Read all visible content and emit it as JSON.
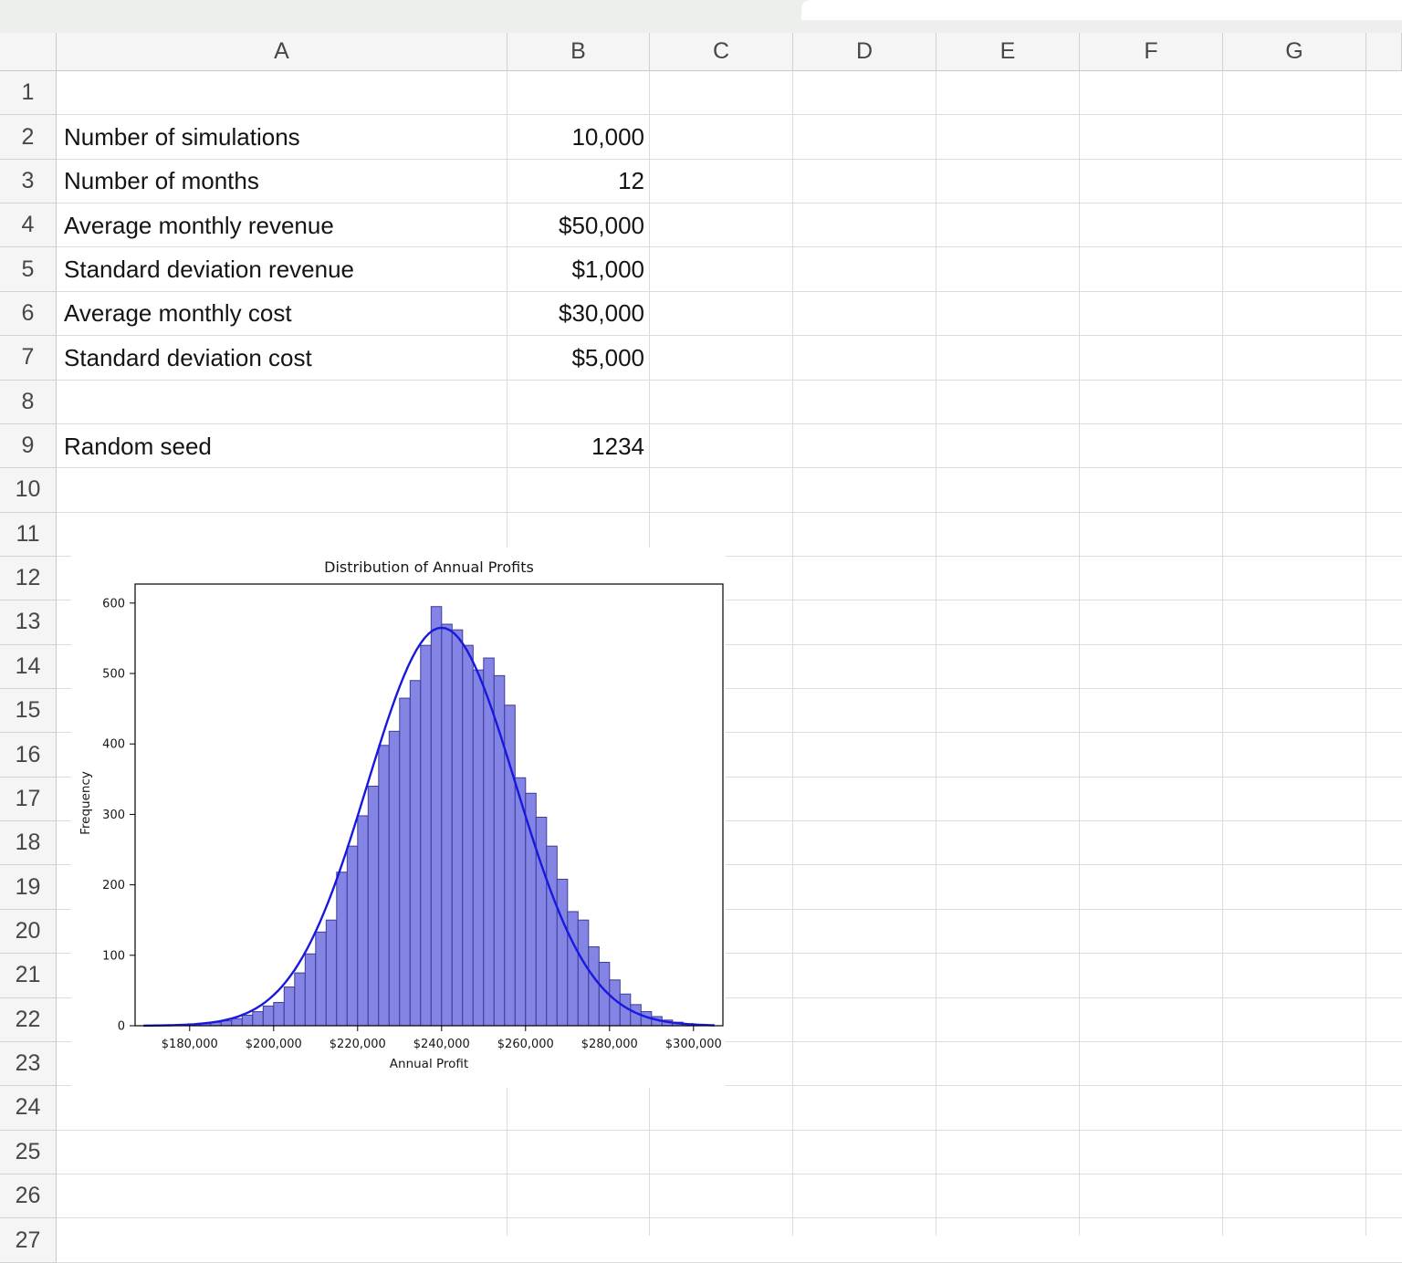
{
  "grid": {
    "columns": [
      "A",
      "B",
      "C",
      "D",
      "E",
      "F",
      "G"
    ],
    "row_count": 27,
    "cells": [
      {
        "ref": "A2",
        "row": 2,
        "col": "A",
        "text": "Number of simulations",
        "align": "left"
      },
      {
        "ref": "B2",
        "row": 2,
        "col": "B",
        "text": "10,000",
        "align": "right"
      },
      {
        "ref": "A3",
        "row": 3,
        "col": "A",
        "text": "Number of months",
        "align": "left"
      },
      {
        "ref": "B3",
        "row": 3,
        "col": "B",
        "text": "12",
        "align": "right"
      },
      {
        "ref": "A4",
        "row": 4,
        "col": "A",
        "text": "Average monthly revenue",
        "align": "left"
      },
      {
        "ref": "B4",
        "row": 4,
        "col": "B",
        "text": "$50,000",
        "align": "right"
      },
      {
        "ref": "A5",
        "row": 5,
        "col": "A",
        "text": "Standard deviation revenue",
        "align": "left"
      },
      {
        "ref": "B5",
        "row": 5,
        "col": "B",
        "text": "$1,000",
        "align": "right"
      },
      {
        "ref": "A6",
        "row": 6,
        "col": "A",
        "text": "Average monthly cost",
        "align": "left"
      },
      {
        "ref": "B6",
        "row": 6,
        "col": "B",
        "text": "$30,000",
        "align": "right"
      },
      {
        "ref": "A7",
        "row": 7,
        "col": "A",
        "text": "Standard deviation cost",
        "align": "left"
      },
      {
        "ref": "B7",
        "row": 7,
        "col": "B",
        "text": "$5,000",
        "align": "right"
      },
      {
        "ref": "A9",
        "row": 9,
        "col": "A",
        "text": "Random seed",
        "align": "left"
      },
      {
        "ref": "B9",
        "row": 9,
        "col": "B",
        "text": "1234",
        "align": "right"
      }
    ]
  },
  "chart_data": {
    "type": "bar",
    "subtype": "histogram_with_density_curve",
    "title": "Distribution of Annual Profits",
    "xlabel": "Annual Profit",
    "ylabel": "Frequency",
    "bin_start": 177500,
    "bin_width": 2500,
    "values": [
      1,
      2,
      3,
      5,
      7,
      10,
      15,
      20,
      28,
      33,
      55,
      75,
      102,
      133,
      150,
      218,
      255,
      298,
      340,
      398,
      418,
      465,
      490,
      540,
      595,
      570,
      562,
      540,
      505,
      522,
      497,
      455,
      352,
      330,
      296,
      255,
      208,
      162,
      150,
      112,
      90,
      65,
      45,
      30,
      20,
      13,
      8,
      5,
      3,
      2
    ],
    "curve": {
      "shape": "normal",
      "mean": 240000,
      "sd": 17664,
      "peak": 565
    },
    "x_ticks": [
      180000,
      200000,
      220000,
      240000,
      260000,
      280000,
      300000
    ],
    "x_tick_labels": [
      "$180,000",
      "$200,000",
      "$220,000",
      "$240,000",
      "$260,000",
      "$280,000",
      "$300,000"
    ],
    "y_ticks": [
      0,
      100,
      200,
      300,
      400,
      500,
      600
    ],
    "xlim": [
      167000,
      307000
    ],
    "ylim": [
      0,
      627
    ],
    "grid_on": false,
    "legend": "none",
    "colors": {
      "bar_fill": "#8484e4",
      "bar_edge": "#3c3c9a",
      "curve": "#1818df",
      "axis": "#000000"
    }
  }
}
